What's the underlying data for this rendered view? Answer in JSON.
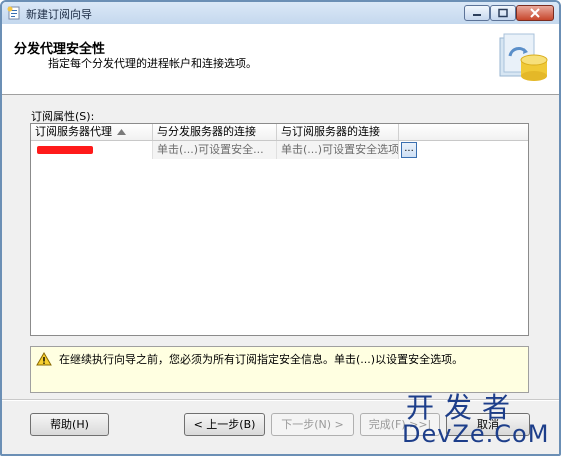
{
  "window": {
    "title": "新建订阅向导"
  },
  "header": {
    "title": "分发代理安全性",
    "subtitle": "指定每个分发代理的进程帐户和连接选项。"
  },
  "grid": {
    "label": "订阅属性(S):",
    "columns": [
      "订阅服务器代理",
      "与分发服务器的连接",
      "与订阅服务器的连接"
    ],
    "sort_column": "订阅服务器代理",
    "rows": [
      {
        "agent": "",
        "distributor_connection": "单击(...)可设置安全...",
        "subscriber_connection": "单击(...)可设置安全选项",
        "button": "..."
      }
    ]
  },
  "warning": {
    "text": "在继续执行向导之前，您必须为所有订阅指定安全信息。单击(...)以设置安全选项。"
  },
  "buttons": {
    "help": "帮助(H)",
    "back": "< 上一步(B)",
    "next": "下一步(N) >",
    "finish": "完成(F) >>|",
    "cancel": "取消"
  },
  "watermark": {
    "line1": "开发者",
    "line2": "DevZe.CoM"
  },
  "colors": {
    "title_gradient_top": "#dbe8f7",
    "close_button": "#c7462c",
    "warning_bg": "#ffffe1",
    "redaction": "#ff1a1a",
    "watermark": "#1d3e8a"
  }
}
